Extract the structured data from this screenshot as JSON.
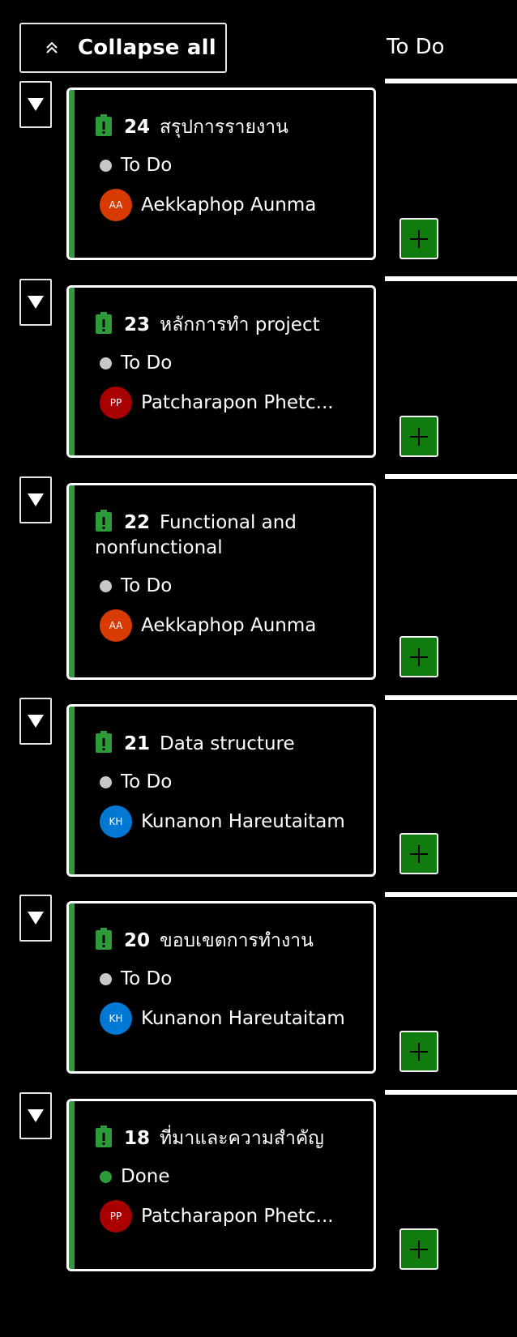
{
  "header": {
    "collapse_label": "Collapse all",
    "column_title": "To Do"
  },
  "colors": {
    "background": "#000000",
    "card_stripe": "#2e9b3a",
    "task_icon": "#2e9b3a",
    "add_button": "#107c10",
    "todo_dot": "#c8c8c8",
    "done_dot": "#2e9b3a"
  },
  "icons": {
    "collapse": "double-chevron-up-icon",
    "toggle": "triangle-down-icon",
    "task": "clipboard-icon",
    "add": "plus-icon"
  },
  "cards": [
    {
      "id": "24",
      "title": "สรุปการรายงาน",
      "state": "To Do",
      "assignee": "Aekkaphop Aunma",
      "initials": "AA",
      "avatar_color": "#d83b01"
    },
    {
      "id": "23",
      "title": "หลักการทำ project",
      "state": "To Do",
      "assignee": "Patcharapon Phetc...",
      "initials": "PP",
      "avatar_color": "#a80000"
    },
    {
      "id": "22",
      "title": "Functional and nonfunctional",
      "state": "To Do",
      "assignee": "Aekkaphop Aunma",
      "initials": "AA",
      "avatar_color": "#d83b01"
    },
    {
      "id": "21",
      "title": "Data structure",
      "state": "To Do",
      "assignee": "Kunanon Hareutaitam",
      "initials": "KH",
      "avatar_color": "#0078d4"
    },
    {
      "id": "20",
      "title": "ขอบเขตการทำงาน",
      "state": "To Do",
      "assignee": "Kunanon Hareutaitam",
      "initials": "KH",
      "avatar_color": "#0078d4"
    },
    {
      "id": "18",
      "title": "ที่มาและความสำคัญ",
      "state": "Done",
      "assignee": "Patcharapon Phetc...",
      "initials": "PP",
      "avatar_color": "#a80000"
    }
  ]
}
